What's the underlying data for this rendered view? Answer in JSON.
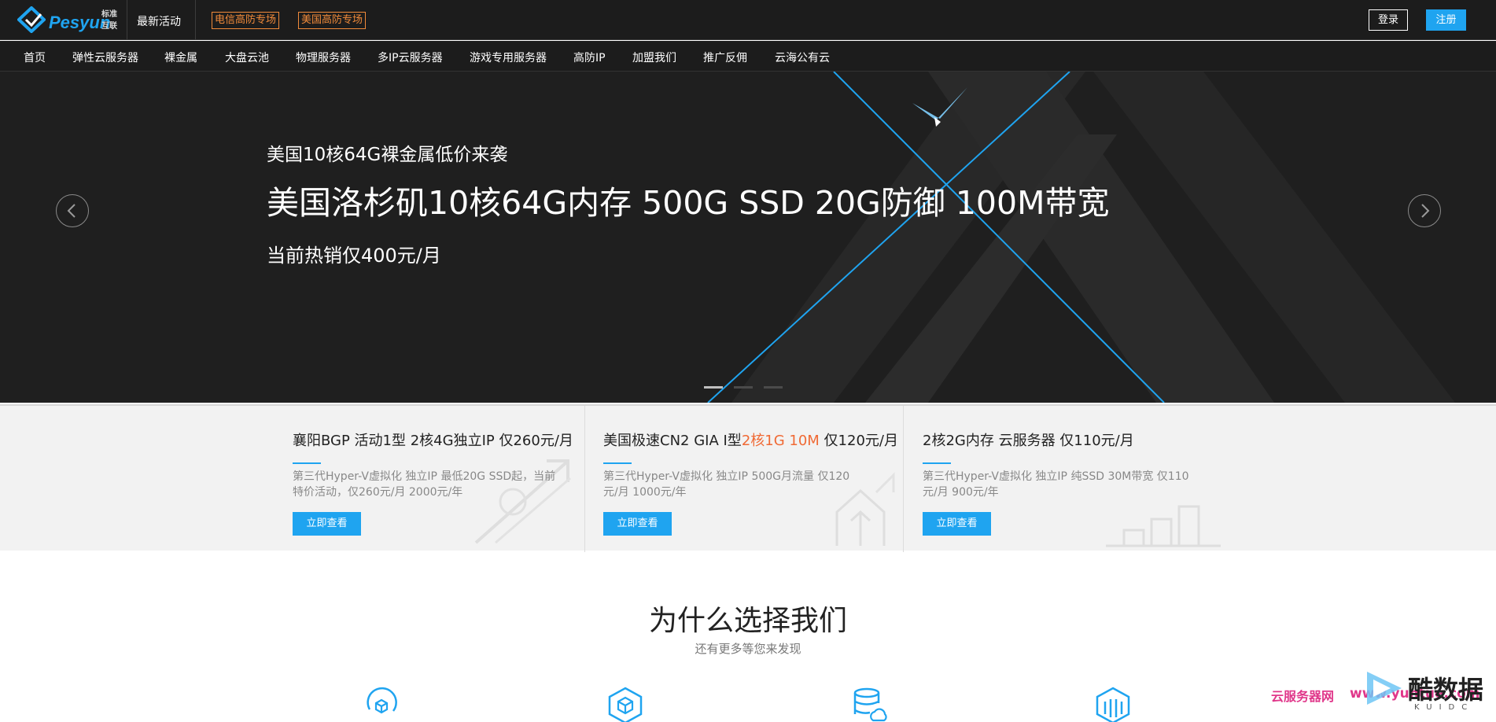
{
  "header": {
    "logo_name": "Pesyun",
    "logo_sub": "标准互联",
    "latest": "最新活动",
    "promos": [
      "电信高防专场",
      "美国高防专场"
    ],
    "login": "登录",
    "register": "注册",
    "accent_color": "#1fa4f0",
    "promo_color": "#f08a3a"
  },
  "nav": {
    "items": [
      "首页",
      "弹性云服务器",
      "裸金属",
      "大盘云池",
      "物理服务器",
      "多IP云服务器",
      "游戏专用服务器",
      "高防IP",
      "加盟我们",
      "推广反佣",
      "云海公有云"
    ]
  },
  "hero": {
    "subtitle": "美国10核64G裸金属低价来袭",
    "title": "美国洛杉矶10核64G内存 500G SSD 20G防御 100M带宽",
    "price": "当前热销仅400元/月",
    "slides": 3,
    "active_slide": 1,
    "prev_icon": "chevron-left-icon",
    "next_icon": "chevron-right-icon"
  },
  "products": [
    {
      "title": "襄阳BGP 活动1型 2核4G独立IP 仅260元/月",
      "desc": "第三代Hyper-V虚拟化 独立IP 最低20G SSD起，当前特价活动，仅260元/月 2000元/年",
      "button": "立即查看"
    },
    {
      "title_before": "美国极速CN2 GIA I型",
      "title_highlight": "2核1G 10M",
      "title_after": " 仅120元/月",
      "desc": "第三代Hyper-V虚拟化 独立IP 500G月流量 仅120元/月 1000元/年",
      "button": "立即查看"
    },
    {
      "title": "2核2G内存 云服务器 仅110元/月",
      "desc": "第三代Hyper-V虚拟化 独立IP 纯SSD 30M带宽 仅110元/月 900元/年",
      "button": "立即查看"
    }
  ],
  "why": {
    "title": "为什么选择我们",
    "subtitle": "还有更多等您来发现",
    "icons": [
      "cube-refresh-icon",
      "hexagon-cube-icon",
      "database-cloud-icon",
      "server-stack-icon"
    ]
  },
  "watermark": {
    "cn": "云服务器网",
    "url": "www.yuntue.com",
    "big": "酷数据",
    "en": "KUIDC"
  }
}
